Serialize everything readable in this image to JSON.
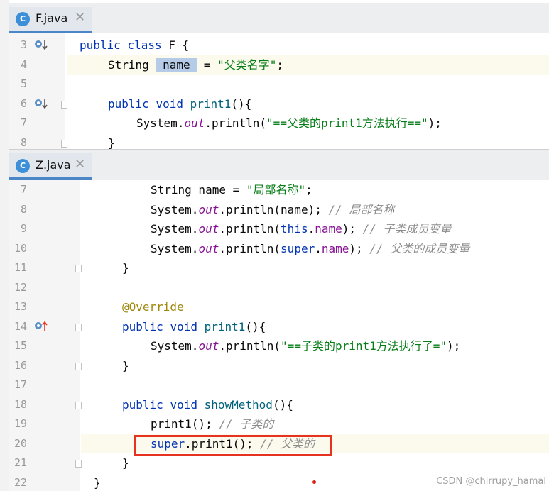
{
  "top_pane": {
    "tab": {
      "icon": "C",
      "label": "F.java",
      "close": "✕"
    },
    "lines": [
      {
        "num": "3",
        "parts": [
          [
            "kw",
            "public"
          ],
          [
            "p",
            " "
          ],
          [
            "kw",
            "class"
          ],
          [
            "p",
            " F {"
          ]
        ]
      },
      {
        "num": "4",
        "parts": [
          [
            "p",
            "String "
          ],
          [
            "sel",
            " name "
          ],
          [
            "p",
            " = "
          ],
          [
            "str",
            "\"父类名字\""
          ],
          [
            "p",
            ";"
          ]
        ]
      },
      {
        "num": "5",
        "parts": []
      },
      {
        "num": "6",
        "parts": [
          [
            "kw",
            "public"
          ],
          [
            "p",
            " "
          ],
          [
            "kw",
            "void"
          ],
          [
            "p",
            " "
          ],
          [
            "fn",
            "print1"
          ],
          [
            "p",
            "(){"
          ]
        ]
      },
      {
        "num": "7",
        "parts": [
          [
            "p",
            "System."
          ],
          [
            "fld",
            "out"
          ],
          [
            "p",
            ".println("
          ],
          [
            "str",
            "\"==父类的print1方法执行==\""
          ],
          [
            "p",
            ");"
          ]
        ]
      },
      {
        "num": "8",
        "parts": [
          [
            "p",
            "}"
          ]
        ]
      }
    ]
  },
  "bottom_pane": {
    "tab": {
      "icon": "C",
      "label": "Z.java",
      "close": "✕"
    },
    "lines": [
      {
        "num": "7",
        "parts": [
          [
            "p",
            "String name = "
          ],
          [
            "str",
            "\"局部名称\""
          ],
          [
            "p",
            ";"
          ]
        ]
      },
      {
        "num": "8",
        "parts": [
          [
            "p",
            "System."
          ],
          [
            "fld",
            "out"
          ],
          [
            "p",
            ".println(name); "
          ],
          [
            "cm",
            "// 局部名称"
          ]
        ]
      },
      {
        "num": "9",
        "parts": [
          [
            "p",
            "System."
          ],
          [
            "fld",
            "out"
          ],
          [
            "p",
            ".println("
          ],
          [
            "kw",
            "this"
          ],
          [
            "p",
            "."
          ],
          [
            "fld2",
            "name"
          ],
          [
            "p",
            "); "
          ],
          [
            "cm",
            "// 子类成员变量"
          ]
        ]
      },
      {
        "num": "10",
        "parts": [
          [
            "p",
            "System."
          ],
          [
            "fld",
            "out"
          ],
          [
            "p",
            ".println("
          ],
          [
            "kw",
            "super"
          ],
          [
            "p",
            "."
          ],
          [
            "fld2",
            "name"
          ],
          [
            "p",
            "); "
          ],
          [
            "cm",
            "// 父类的成员变量"
          ]
        ]
      },
      {
        "num": "11",
        "parts": [
          [
            "p",
            "}"
          ]
        ]
      },
      {
        "num": "12",
        "parts": []
      },
      {
        "num": "13",
        "parts": [
          [
            "ann",
            "@Override"
          ]
        ]
      },
      {
        "num": "14",
        "parts": [
          [
            "kw",
            "public"
          ],
          [
            "p",
            " "
          ],
          [
            "kw",
            "void"
          ],
          [
            "p",
            " "
          ],
          [
            "fn",
            "print1"
          ],
          [
            "p",
            "(){"
          ]
        ]
      },
      {
        "num": "15",
        "parts": [
          [
            "p",
            "System."
          ],
          [
            "fld",
            "out"
          ],
          [
            "p",
            ".println("
          ],
          [
            "str",
            "\"==子类的print1方法执行了=\""
          ],
          [
            "p",
            ");"
          ]
        ]
      },
      {
        "num": "16",
        "parts": [
          [
            "p",
            "}"
          ]
        ]
      },
      {
        "num": "17",
        "parts": []
      },
      {
        "num": "18",
        "parts": [
          [
            "kw",
            "public"
          ],
          [
            "p",
            " "
          ],
          [
            "kw",
            "void"
          ],
          [
            "p",
            " "
          ],
          [
            "fn",
            "showMethod"
          ],
          [
            "p",
            "(){"
          ]
        ]
      },
      {
        "num": "19",
        "parts": [
          [
            "p",
            "print1(); "
          ],
          [
            "cm",
            "// 子类的"
          ]
        ]
      },
      {
        "num": "20",
        "parts": [
          [
            "kw",
            "super"
          ],
          [
            "p",
            ".print1(); "
          ],
          [
            "cm",
            "// 父类的"
          ]
        ]
      },
      {
        "num": "21",
        "parts": [
          [
            "p",
            "}"
          ]
        ]
      },
      {
        "num": "22",
        "parts": [
          [
            "p",
            "}"
          ]
        ]
      }
    ]
  },
  "watermark": "CSDN @chirrupy_hamal",
  "colors": {
    "keyword": "#0033b3",
    "string": "#067d17",
    "field": "#871094",
    "comment": "#8c8c8c",
    "annotation": "#9e880d",
    "highlight_box": "#e5331f"
  }
}
